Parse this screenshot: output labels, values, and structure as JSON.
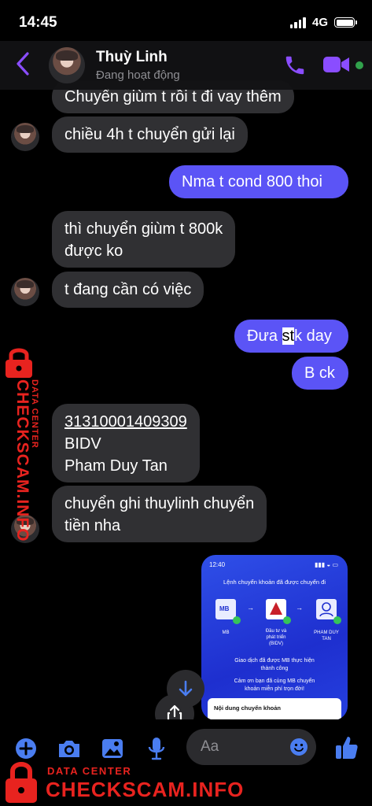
{
  "status": {
    "time": "14:45",
    "network": "4G"
  },
  "header": {
    "contact_name": "Thuỳ Linh",
    "presence": "Đang hoạt động"
  },
  "messages": [
    {
      "dir": "in",
      "text": "Chuyển giùm t rồi t đi vay thêm"
    },
    {
      "dir": "in",
      "text": "chiều 4h t chuyển gửi lại"
    },
    {
      "dir": "out",
      "text": "Nma t cond 800 thoi"
    },
    {
      "dir": "in",
      "line1": "thì chuyển giùm t 800k",
      "line2": "được ko"
    },
    {
      "dir": "in",
      "text": "t đang cần có việc"
    },
    {
      "dir": "out",
      "pre": "Đưa ",
      "highlight": "st",
      "post": "k day"
    },
    {
      "dir": "out",
      "text": "B ck"
    },
    {
      "dir": "in",
      "account_number": "31310001409309",
      "bank": "BIDV",
      "holder": "Pham Duy Tan"
    },
    {
      "dir": "in",
      "line1": "chuyển ghi thuylinh chuyển",
      "line2": "tiền nha"
    }
  ],
  "attachment": {
    "time": "12:40",
    "title": "Lệnh chuyển khoản đã được chuyển đi",
    "from_logo": "MB",
    "from_label": "MB",
    "bank_label_1": "Đầu tư và",
    "bank_label_2": "phát triển",
    "bank_label_3": "(BIDV)",
    "to_label_1": "PHAM DUY",
    "to_label_2": "TAN",
    "note_1": "Giao dịch đã được MB thực hiện",
    "note_2": "thành công",
    "thanks_1": "Cảm ơn bạn đã cùng MB chuyển",
    "thanks_2": "khoản miễn phí trọn đời!",
    "card_title": "Nội dung chuyển khoản"
  },
  "composer": {
    "placeholder": "Aa"
  },
  "watermark": {
    "small": "DATA CENTER",
    "brand": "CHECKSCAM.INFO"
  },
  "colors": {
    "accent": "#8a4dff",
    "outgoing": "#5b54f6",
    "incoming": "#303033",
    "watermark": "#e8231f",
    "composer_icons": "#4a7df0"
  }
}
